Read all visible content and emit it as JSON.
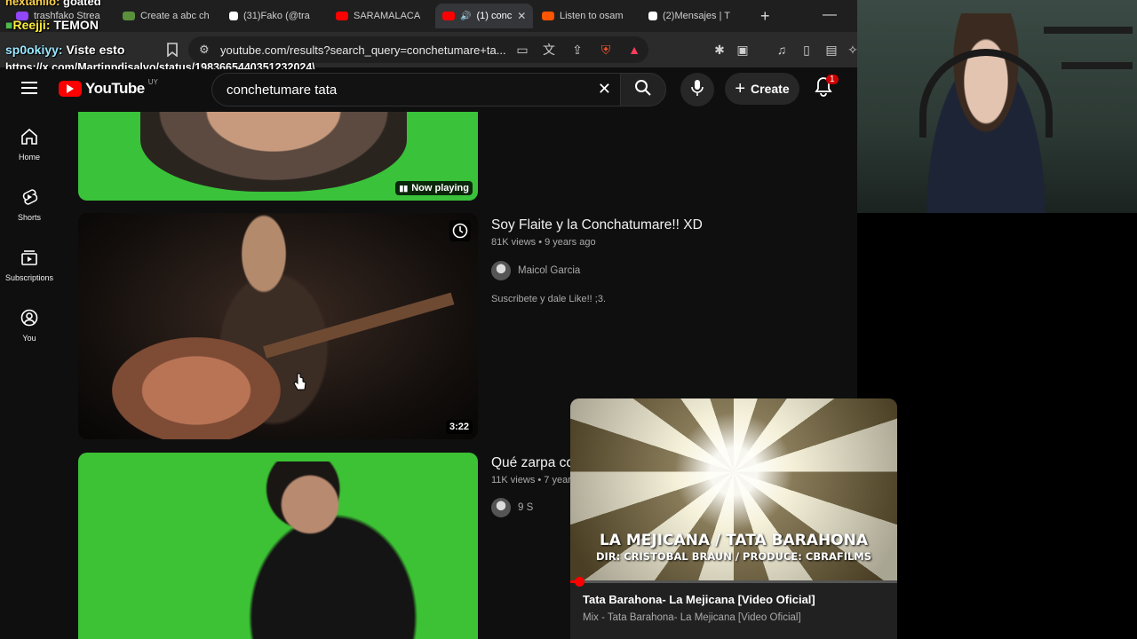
{
  "tabs": [
    {
      "label": "trashfako Strea",
      "color": "#9146ff",
      "active": false
    },
    {
      "label": "Create a abc ch",
      "color": "#5a8f3c",
      "active": false
    },
    {
      "label": "(31)Fako (@tra",
      "color": "#ffffff",
      "active": false
    },
    {
      "label": "SARAMALACA",
      "color": "#ff0000",
      "active": false
    },
    {
      "label": "(1) conc",
      "color": "#ff0000",
      "active": true
    },
    {
      "label": "Listen to osam",
      "color": "#ff5500",
      "active": false
    },
    {
      "label": "(2)Mensajes | T",
      "color": "#ffffff",
      "active": false
    }
  ],
  "address": {
    "url": "youtube.com/results?search_query=conchetumare+ta..."
  },
  "chat_overlay": [
    {
      "user": "hextanilo:",
      "msg": "goated"
    },
    {
      "user": "Reejji:",
      "msg": "TEMON"
    },
    {
      "user": "sp0okiyy:",
      "msg": "Viste esto"
    },
    {
      "user": "",
      "msg": "https://x.com/Martinpdisalvo/status/1983665440351232024\\"
    }
  ],
  "youtube": {
    "logo": "YouTube",
    "region": "UY",
    "search_value": "conchetumare tata",
    "create_label": "Create",
    "notif_count": "1",
    "nav": [
      {
        "label": "Home",
        "icon": "home-icon"
      },
      {
        "label": "Shorts",
        "icon": "shorts-icon"
      },
      {
        "label": "Subscriptions",
        "icon": "subscriptions-icon"
      },
      {
        "label": "You",
        "icon": "you-icon"
      }
    ]
  },
  "results": [
    {
      "now_playing": "Now playing"
    },
    {
      "title": "Soy Flaite y la Conchatumare!! XD",
      "meta": "81K views • 9 years ago",
      "channel": "Maicol Garcia",
      "desc": "Suscribete y dale Like!! ;3.",
      "duration": "3:22"
    },
    {
      "title": "Qué zarpa co",
      "meta": "11K views • 7 year",
      "channel": "9 S"
    }
  ],
  "miniplayer": {
    "overlay_line1": "LA MEJICANA / TATA BARAHONA",
    "overlay_line2": "DIR: CRISTOBAL BRAUN / PRODUCE: CBRAFILMS",
    "title": "Tata Barahona- La Mejicana [Video Oficial]",
    "subtitle": "Mix - Tata Barahona- La Mejicana [Video Oficial]",
    "progress": 0.03
  }
}
